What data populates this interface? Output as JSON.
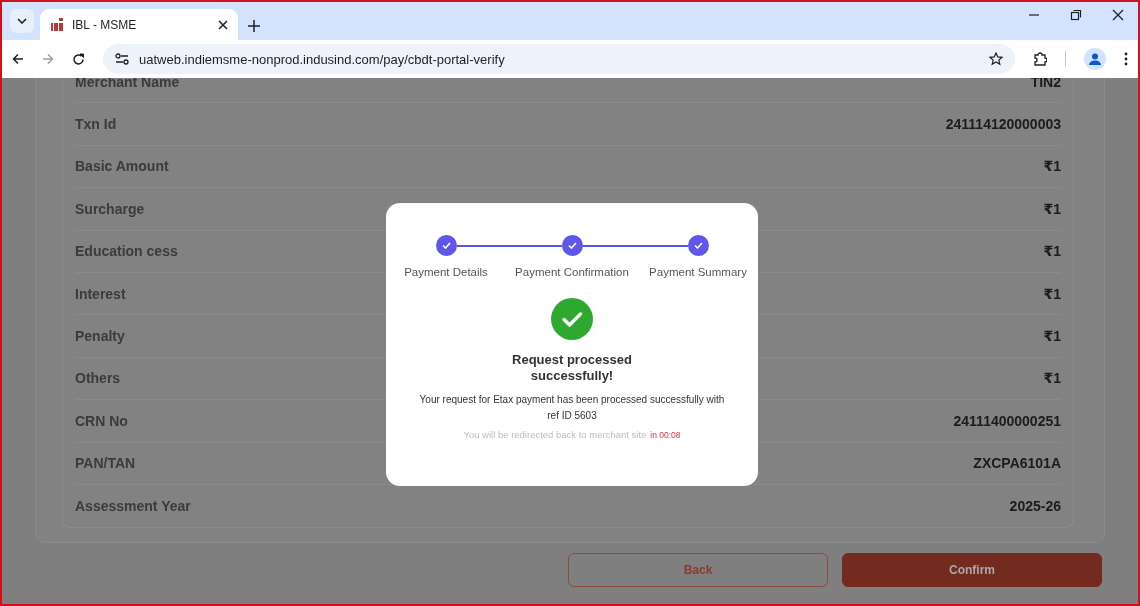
{
  "browser": {
    "tabs": [
      {
        "title": "IBL - MSME",
        "selected": true
      }
    ],
    "url": "uatweb.indiemsme-nonprod.indusind.com/pay/cbdt-portal-verify",
    "forward_disabled": true
  },
  "details": {
    "rows": [
      {
        "label": "Merchant Name",
        "value": "TIN2"
      },
      {
        "label": "Txn Id",
        "value": "241114120000003"
      },
      {
        "label": "Basic Amount",
        "value": "₹1"
      },
      {
        "label": "Surcharge",
        "value": "₹1"
      },
      {
        "label": "Education cess",
        "value": "₹1"
      },
      {
        "label": "Interest",
        "value": "₹1"
      },
      {
        "label": "Penalty",
        "value": "₹1"
      },
      {
        "label": "Others",
        "value": "₹1"
      },
      {
        "label": "CRN No",
        "value": "24111400000251"
      },
      {
        "label": "PAN/TAN",
        "value": "ZXCPA6101A"
      },
      {
        "label": "Assessment Year",
        "value": "2025-26"
      }
    ]
  },
  "buttons": [
    {
      "label": "Back",
      "kind": "outline"
    },
    {
      "label": "Confirm",
      "kind": "primary"
    }
  ],
  "modal": {
    "steps": [
      {
        "label": "Payment Details",
        "done": true
      },
      {
        "label": "Payment Confirmation",
        "done": true
      },
      {
        "label": "Payment Summary",
        "done": true
      }
    ],
    "title": "Request processed successfully!",
    "message": "Your request for Etax payment has been processed successfully with ref ID 5603",
    "redirect_note": "You will be redirected back to merchant site",
    "countdown": "in 00:08"
  }
}
